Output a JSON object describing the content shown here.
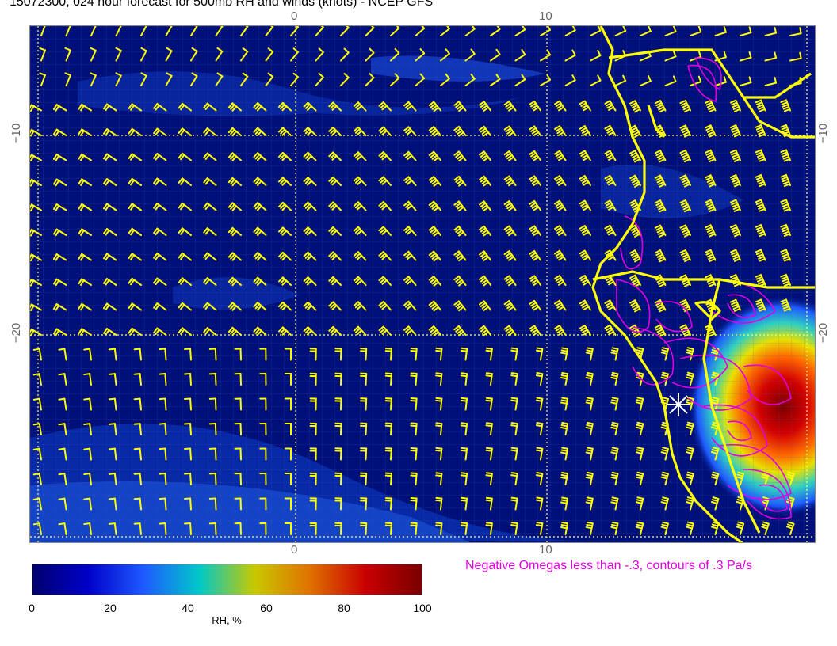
{
  "title": "15072300, 024 hour forecast for 500mb RH and winds (knots) - NCEP GFS",
  "grid_labels": {
    "top": [
      "0",
      "10"
    ],
    "bottom": [
      "0",
      "10"
    ],
    "left": [
      "−10",
      "−20"
    ],
    "right": [
      "−10",
      "−20"
    ]
  },
  "colorbar": {
    "title": "RH, %",
    "ticks": [
      "0",
      "20",
      "40",
      "60",
      "80",
      "100"
    ],
    "colors": [
      "#00006e",
      "#0000c8",
      "#1e5aff",
      "#00c8c8",
      "#c8c800",
      "#e07000",
      "#c80000",
      "#7a0000"
    ]
  },
  "omega_note": "Negative Omegas less than -.3, contours of .3 Pa/s",
  "colors": {
    "background": "#00107a",
    "barb": "#ffff00",
    "coast": "#ffff00",
    "omega": "#e000e0",
    "gridline": "#ffff66"
  }
}
